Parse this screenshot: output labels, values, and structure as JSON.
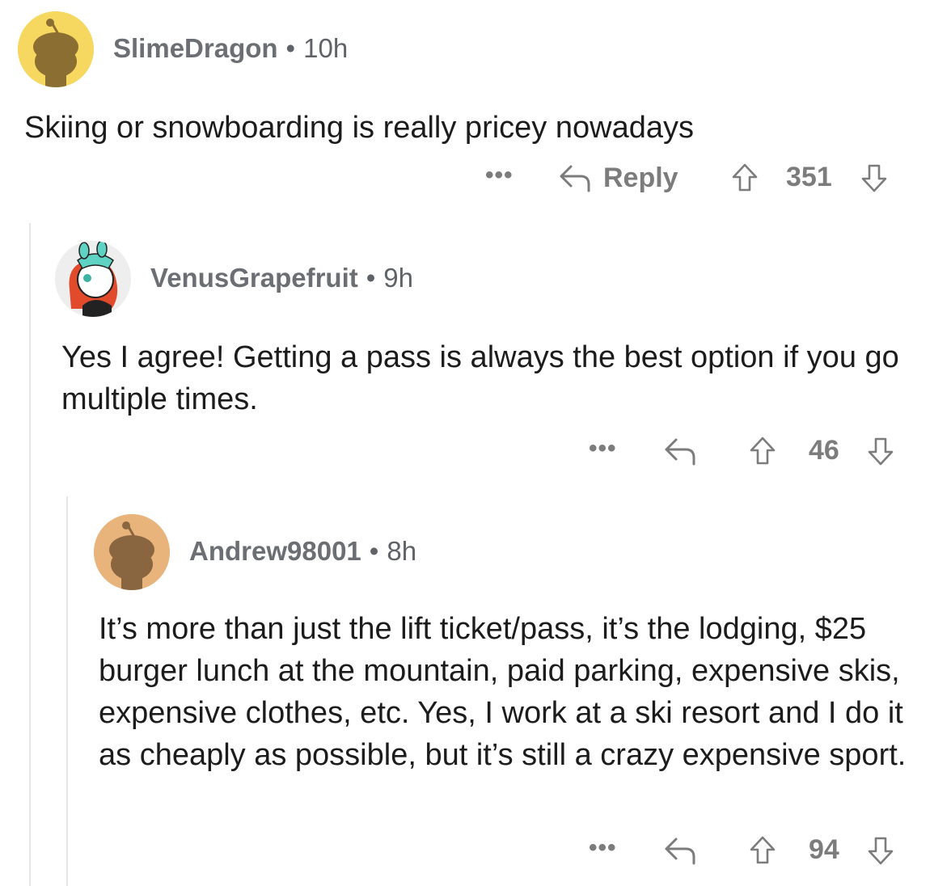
{
  "comments": [
    {
      "username": "SlimeDragon",
      "age": "10h",
      "text": "Skiing or snowboarding is really pricey nowadays",
      "reply_label": "Reply",
      "score": "351",
      "avatar_color": "#f6d860"
    },
    {
      "username": "VenusGrapefruit",
      "age": "9h",
      "text": "Yes I agree! Getting a pass is always the best option if you go multiple times.",
      "score": "46",
      "avatar_color": "#eeeeee"
    },
    {
      "username": "Andrew98001",
      "age": "8h",
      "text": "It’s more than just the lift ticket/pass, it’s the lodging, $25 burger lunch at the mountain, paid parking, expensive skis, expensive clothes, etc. Yes, I work at a ski resort and I do it as cheaply as possible, but it’s still a crazy expensive sport.",
      "score": "94",
      "avatar_color": "#e8b47c"
    }
  ],
  "separator": "•",
  "more_label": "•••",
  "colors": {
    "meta_gray": "#7c7c7c",
    "thread_line": "#e5e5e5"
  }
}
